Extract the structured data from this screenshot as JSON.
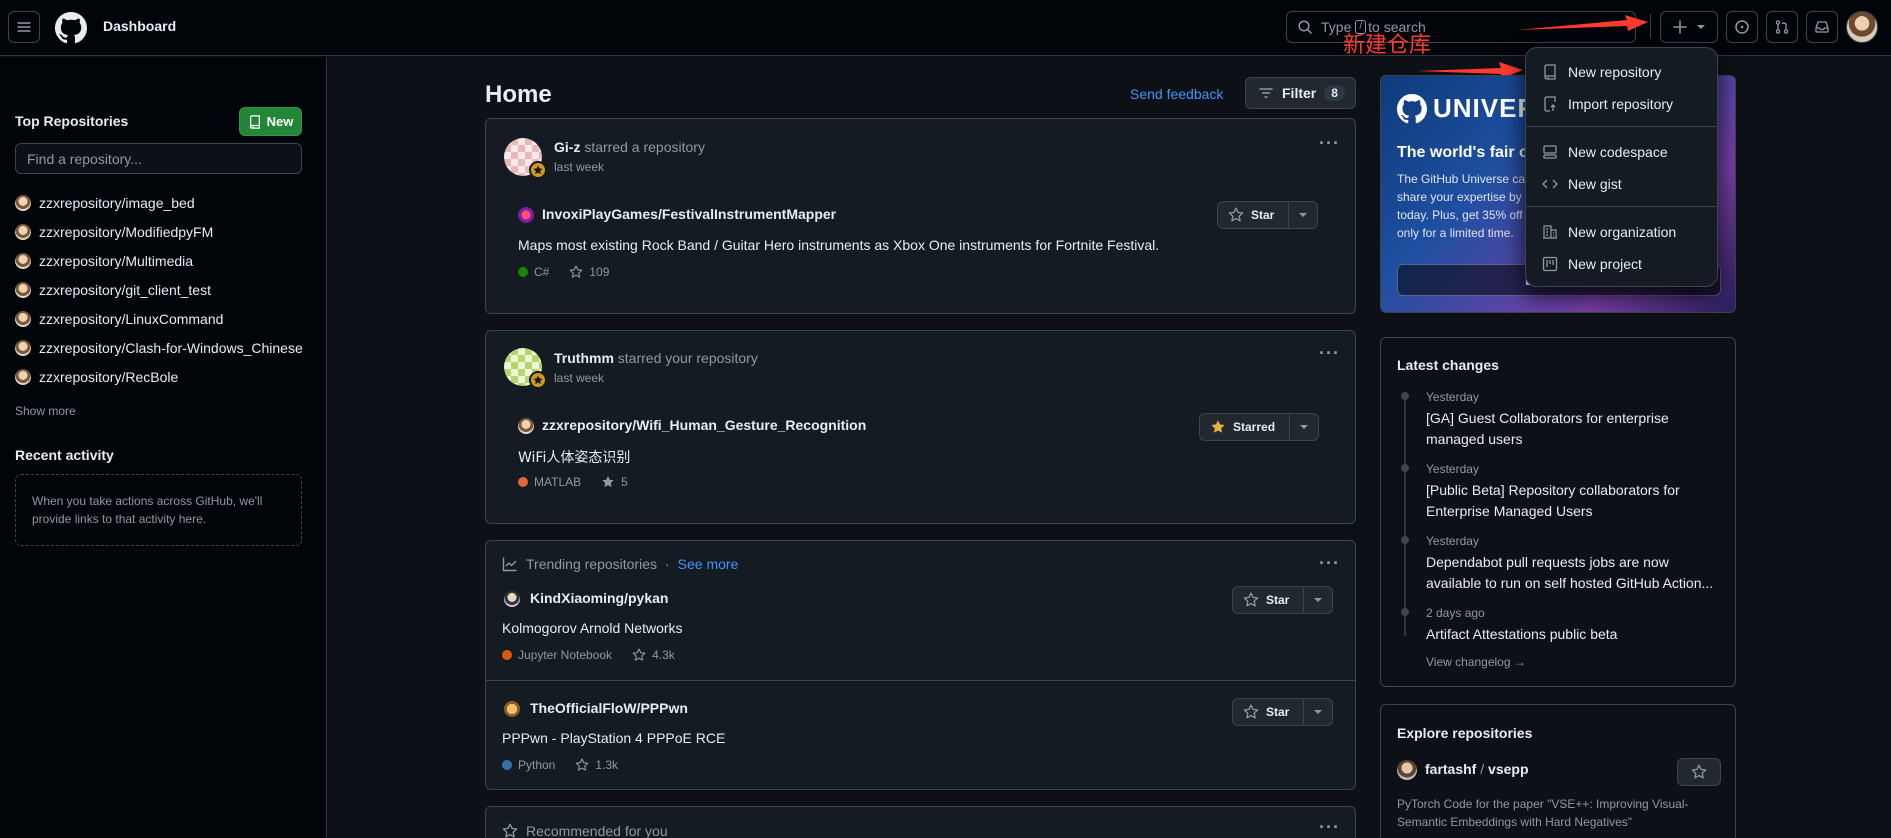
{
  "header": {
    "title": "Dashboard",
    "search_prefix": "Type",
    "search_key": "/",
    "search_suffix": "to search",
    "annotation_label": "新建仓库",
    "annotation_color": "#ff3b30"
  },
  "sidebar": {
    "top_repos_title": "Top Repositories",
    "new_button": "New",
    "find_placeholder": "Find a repository...",
    "repos": [
      "zzxrepository/image_bed",
      "zzxrepository/ModifiedpyFM",
      "zzxrepository/Multimedia",
      "zzxrepository/git_client_test",
      "zzxrepository/LinuxCommand",
      "zzxrepository/Clash-for-Windows_Chinese",
      "zzxrepository/RecBole"
    ],
    "show_more": "Show more",
    "recent_title": "Recent activity",
    "recent_text": "When you take actions across GitHub, we'll provide links to that activity here."
  },
  "main": {
    "home_title": "Home",
    "send_feedback": "Send feedback",
    "filter_label": "Filter",
    "filter_count": "8",
    "feed": [
      {
        "actor": "Gi-z",
        "action": "starred a repository",
        "time": "last week",
        "repo": "InvoxiPlayGames/FestivalInstrumentMapper",
        "description": "Maps most existing Rock Band / Guitar Hero instruments as Xbox One instruments for Fortnite Festival.",
        "language": "C#",
        "language_color": "#178600",
        "stars": "109",
        "star_label": "Star"
      },
      {
        "actor": "Truthmm",
        "action": "starred your repository",
        "time": "last week",
        "repo": "zzxrepository/Wifi_Human_Gesture_Recognition",
        "description": "WiFi人体姿态识别",
        "language": "MATLAB",
        "language_color": "#e16737",
        "stars": "5",
        "star_label": "Starred"
      }
    ],
    "trending": {
      "title": "Trending repositories",
      "separator": "·",
      "see_more": "See more",
      "items": [
        {
          "repo": "KindXiaoming/pykan",
          "description": "Kolmogorov Arnold Networks",
          "language": "Jupyter Notebook",
          "language_color": "#da5b0b",
          "stars": "4.3k",
          "star_label": "Star"
        },
        {
          "repo": "TheOfficialFloW/PPPwn",
          "description": "PPPwn - PlayStation 4 PPPoE RCE",
          "language": "Python",
          "language_color": "#3572a5",
          "stars": "1.3k",
          "star_label": "Star"
        }
      ]
    },
    "recommended_title": "Recommended for you"
  },
  "right": {
    "universe": {
      "logo_text": "UNIVERS",
      "title": "The world's fair of",
      "body_lines": [
        "The GitHub Universe cal",
        "share your expertise by s",
        "today. Plus, get 35% off",
        "only for a limited time."
      ],
      "button_fragment": "L"
    },
    "latest_changes": {
      "title": "Latest changes",
      "items": [
        {
          "date": "Yesterday",
          "lines": [
            "[GA] Guest Collaborators for enterprise",
            "managed users"
          ]
        },
        {
          "date": "Yesterday",
          "lines": [
            "[Public Beta] Repository collaborators for",
            "Enterprise Managed Users"
          ]
        },
        {
          "date": "Yesterday",
          "lines": [
            "Dependabot pull requests jobs are now",
            "available to run on self hosted GitHub Action..."
          ]
        },
        {
          "date": "2 days ago",
          "lines": [
            "Artifact Attestations public beta"
          ]
        }
      ],
      "view_changelog": "View changelog →"
    },
    "explore": {
      "title": "Explore repositories",
      "owner": "fartashf",
      "slash": "/",
      "name": "vsepp",
      "desc_lines": [
        "PyTorch Code for the paper \"VSE++: Improving Visual-",
        "Semantic Embeddings with Hard Negatives\""
      ]
    }
  },
  "dropdown": {
    "items": [
      "New repository",
      "Import repository",
      "New codespace",
      "New gist",
      "New organization",
      "New project"
    ]
  }
}
